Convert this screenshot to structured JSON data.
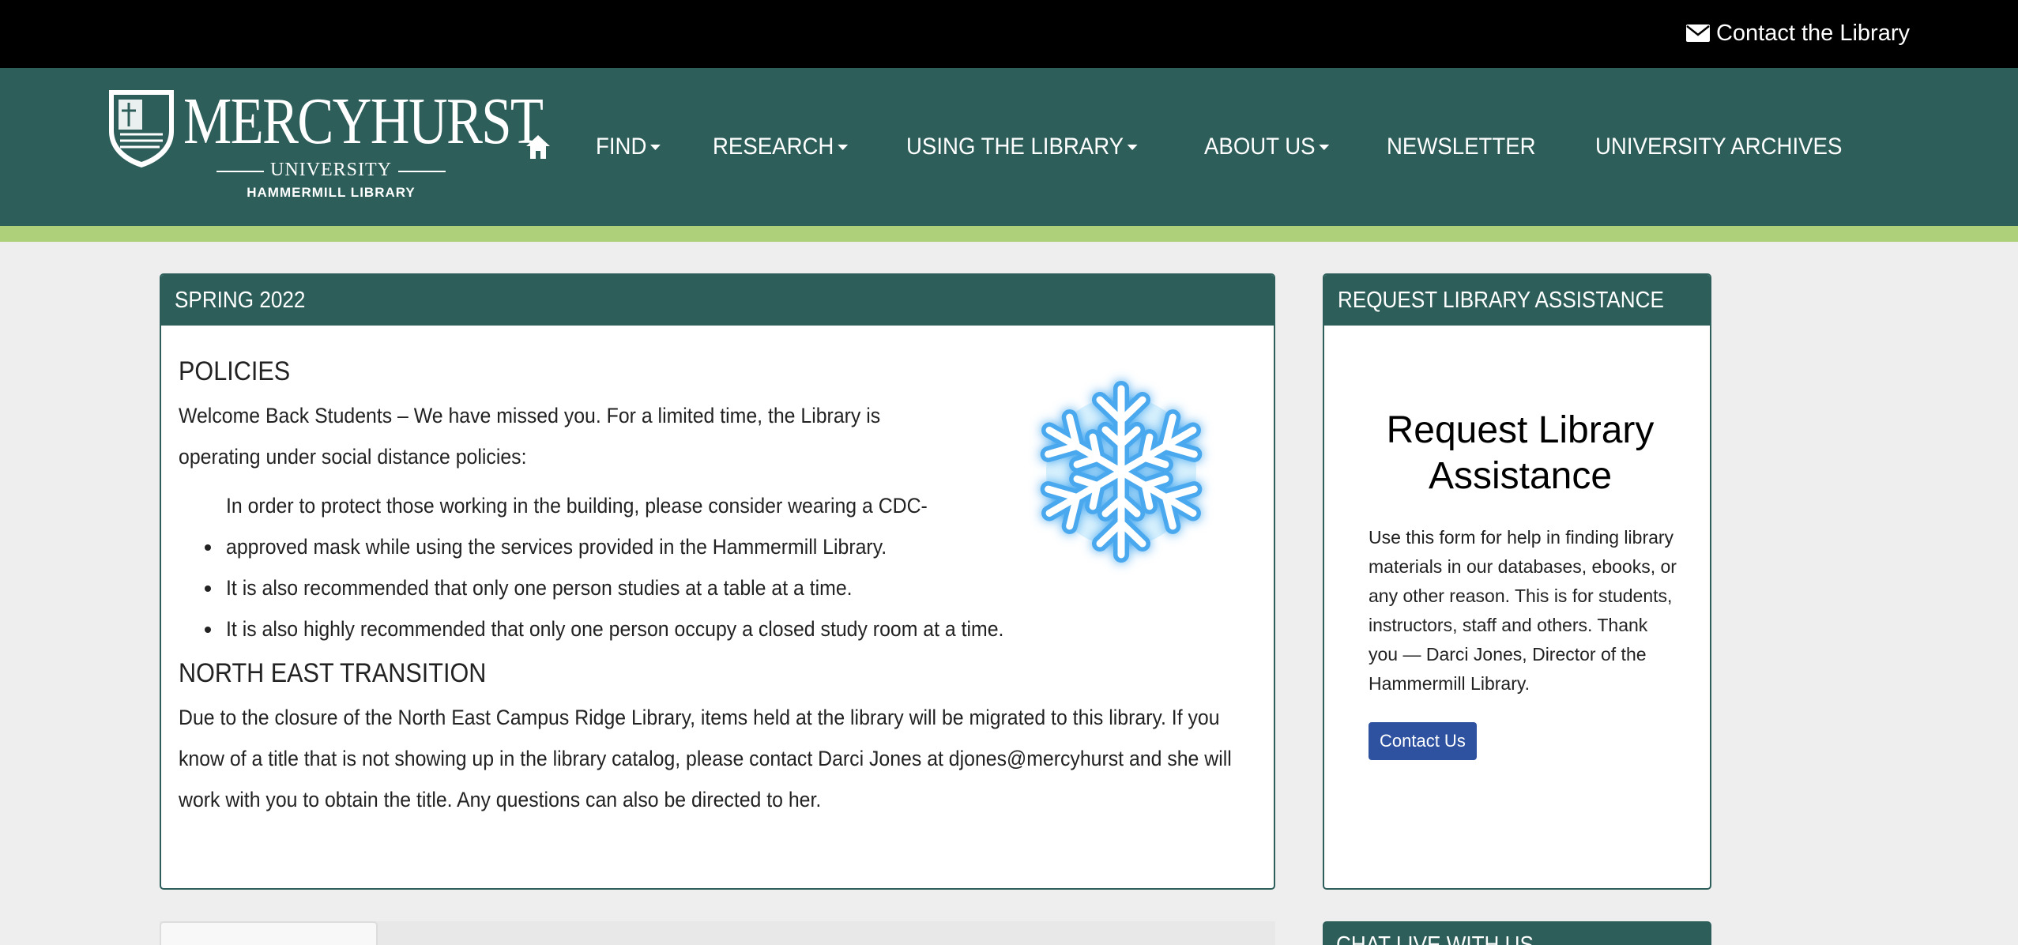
{
  "topbar": {
    "contact_label": "Contact the Library"
  },
  "logo": {
    "name": "MERCYHURST",
    "university": "UNIVERSITY",
    "library": "HAMMERMILL LIBRARY"
  },
  "nav": {
    "items": [
      {
        "label": "FIND",
        "dropdown": true
      },
      {
        "label": "RESEARCH",
        "dropdown": true
      },
      {
        "label": "USING THE LIBRARY",
        "dropdown": true
      },
      {
        "label": "ABOUT US",
        "dropdown": true
      },
      {
        "label": "NEWSLETTER",
        "dropdown": false
      },
      {
        "label": "UNIVERSITY ARCHIVES",
        "dropdown": false
      }
    ]
  },
  "main": {
    "heading": "SPRING 2022",
    "policies_title": "POLICIES",
    "intro": "Welcome Back Students – We have missed you. For a limited time, the Library is operating under social distance policies:",
    "policies": [
      "In order to protect those working in the building, please consider wearing a CDC-approved mask while using the services provided in the Hammermill Library.",
      "It is also recommended that only one person studies at a table at a time.",
      "It is also highly recommended that only one person occupy a closed study room at a time."
    ],
    "transition_title": "NORTH EAST TRANSITION",
    "transition_text": "Due to the closure of the North East Campus Ridge Library, items held at the library will be migrated to this library. If you know of a title that is not showing up in the library catalog, please contact Darci Jones at djones@mercyhurst and she will work with you to obtain the title. Any questions can also be directed to her."
  },
  "side": {
    "heading": "REQUEST LIBRARY ASSISTANCE",
    "title": "Request Library Assistance",
    "text": "Use this form for help in finding library materials in our databases, ebooks, or any other reason. This is for students, instructors, staff and others. Thank you — Darci Jones, Director of the Hammermill Library.",
    "button_label": "Contact Us"
  },
  "bottom": {
    "chat_heading": "CHAT LIVE WITH US"
  },
  "colors": {
    "nav_green": "#2d5e5a",
    "accent_green": "#aed07a",
    "button_blue": "#2e52a0"
  },
  "icons": {
    "contact": "envelope-icon",
    "home": "home-icon",
    "decoration": "snowflake-icon"
  }
}
